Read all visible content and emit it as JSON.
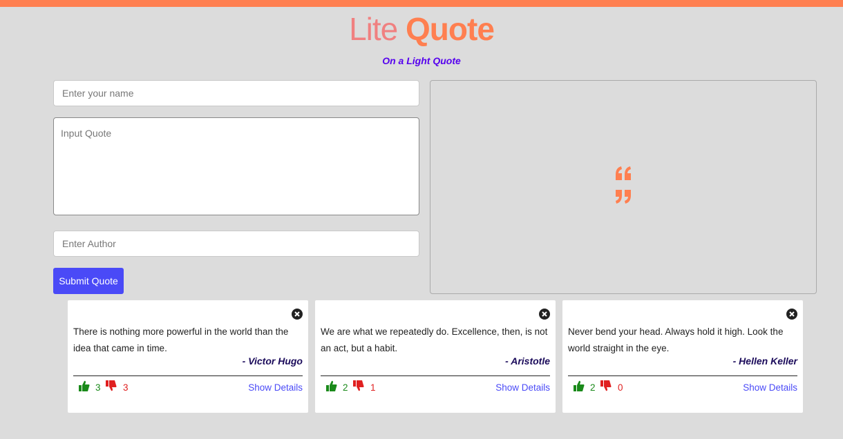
{
  "header": {
    "title_light": "Lite",
    "title_bold": "Quote",
    "subtitle": "On a Light Quote"
  },
  "form": {
    "name_placeholder": "Enter your name",
    "quote_placeholder": "Input Quote",
    "author_placeholder": "Enter Author",
    "submit_label": "Submit Quote"
  },
  "preview": {
    "icon": "quote-icon"
  },
  "colors": {
    "accent": "#ff7f50",
    "submit": "#4a4af7",
    "like": "#1a8a1a",
    "dislike": "#e02020",
    "subtitle": "#5500ee"
  },
  "quotes": [
    {
      "text": "There is nothing more powerful in the world than the idea that came in time.",
      "author": "- Victor Hugo",
      "likes": "3",
      "dislikes": "3",
      "details_label": "Show Details"
    },
    {
      "text": "We are what we repeatedly do. Excellence, then, is not an act, but a habit.",
      "author": "- Aristotle",
      "likes": "2",
      "dislikes": "1",
      "details_label": "Show Details"
    },
    {
      "text": "Never bend your head. Always hold it high. Look the world straight in the eye.",
      "author": "- Hellen Keller",
      "likes": "2",
      "dislikes": "0",
      "details_label": "Show Details"
    }
  ]
}
